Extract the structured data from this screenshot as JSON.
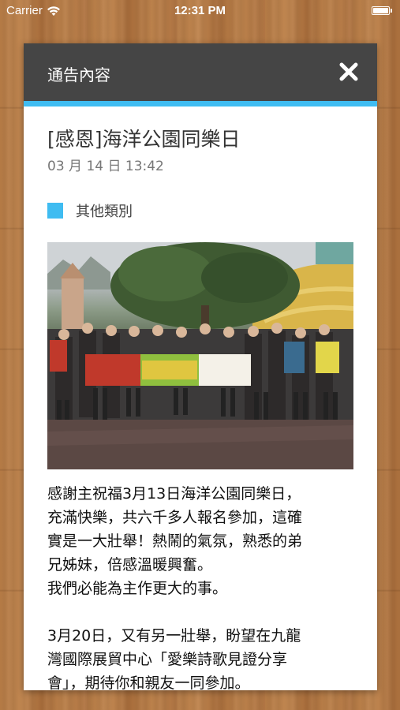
{
  "status_bar": {
    "carrier": "Carrier",
    "time": "12:31 PM",
    "battery_level": 1.0
  },
  "dialog": {
    "header_title": "通告內容",
    "close_icon": "close-icon",
    "accent_color": "#3fbcf1",
    "header_color": "#454545"
  },
  "post": {
    "title": "[感恩]海洋公園同樂日",
    "date": "03 月 14 日 13:42",
    "category": "其他類別",
    "category_color": "#3fbcf1",
    "body": "感謝主祝福3月13日海洋公園同樂日，\n充滿快樂，共六千多人報名參加，這確\n實是一大壯舉！熱鬧的氣氛，熟悉的弟\n兄姊妹，倍感溫暖興奮。\n我們必能為主作更大的事。\n\n3月20日，又有另一壯舉，盼望在九龍\n灣國際展貿中心「愛樂詩歌見證分享\n會」，期待你和親友一同參加。"
  }
}
